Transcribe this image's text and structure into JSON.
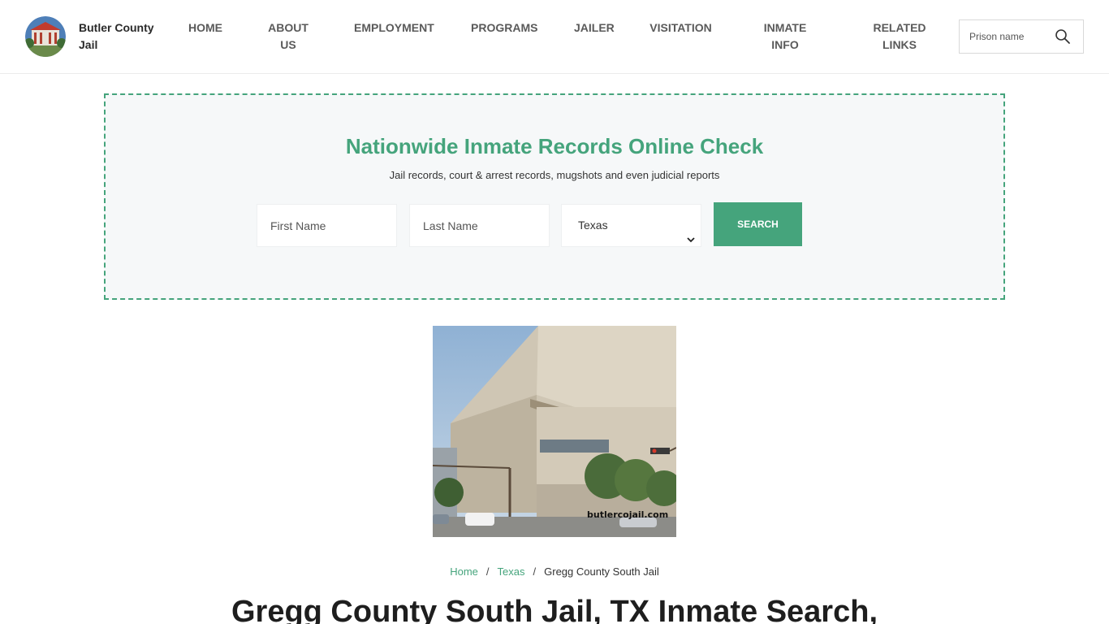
{
  "header": {
    "site_name": "Butler County Jail",
    "nav": [
      "HOME",
      "ABOUT US",
      "EMPLOYMENT",
      "PROGRAMS",
      "JAILER",
      "VISITATION",
      "INMATE INFO",
      "RELATED LINKS"
    ],
    "search_placeholder": "Prison name",
    "search_icon": "search-icon"
  },
  "records_panel": {
    "title": "Nationwide Inmate Records Online Check",
    "subtitle": "Jail records, court & arrest records, mugshots and even judicial reports",
    "first_name_placeholder": "First Name",
    "last_name_placeholder": "Last Name",
    "state_selected": "Texas",
    "search_label": "SEARCH",
    "accent_color": "#45a47c"
  },
  "photo": {
    "watermark": "butlercojail.com"
  },
  "breadcrumb": {
    "home": "Home",
    "state": "Texas",
    "current": "Gregg County South Jail",
    "separator": "/"
  },
  "page": {
    "title": "Gregg County South Jail, TX Inmate Search,"
  }
}
